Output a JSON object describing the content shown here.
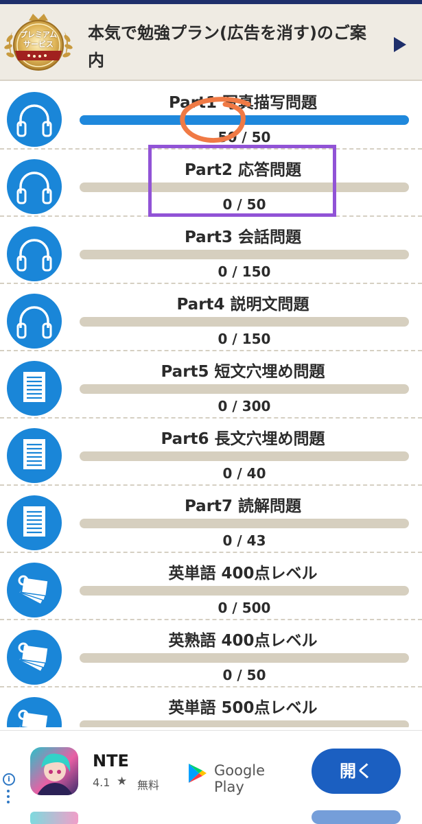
{
  "banner": {
    "badge_line1": "プレミアム",
    "badge_line2": "サービス",
    "title": "本気で勉強プラン(広告を消す)のご案内"
  },
  "rows": [
    {
      "title": "Part1 写真描写問題",
      "count": "50 / 50",
      "progress": 1.0,
      "icon": "headphones-icon"
    },
    {
      "title": "Part2 応答問題",
      "count": "0 / 50",
      "progress": 0,
      "icon": "headphones-icon"
    },
    {
      "title": "Part3 会話問題",
      "count": "0 / 150",
      "progress": 0,
      "icon": "headphones-icon"
    },
    {
      "title": "Part4 説明文問題",
      "count": "0 / 150",
      "progress": 0,
      "icon": "headphones-icon"
    },
    {
      "title": "Part5 短文穴埋め問題",
      "count": "0 / 300",
      "progress": 0,
      "icon": "document-icon"
    },
    {
      "title": "Part6 長文穴埋め問題",
      "count": "0 / 40",
      "progress": 0,
      "icon": "document-icon"
    },
    {
      "title": "Part7 読解問題",
      "count": "0 / 43",
      "progress": 0,
      "icon": "document-icon"
    },
    {
      "title": "英単語 400点レベル",
      "count": "0 / 500",
      "progress": 0,
      "icon": "flashcards-icon"
    },
    {
      "title": "英熟語 400点レベル",
      "count": "0 / 50",
      "progress": 0,
      "icon": "flashcards-icon"
    },
    {
      "title": "英単語 500点レベル",
      "count": "",
      "progress": 0,
      "icon": "flashcards-icon"
    }
  ],
  "ad": {
    "app_name": "NTE",
    "rating": "4.1",
    "price": "無料",
    "store": "Google Play",
    "open_label": "開く",
    "info": "i"
  },
  "colors": {
    "accent": "#1a86d8",
    "bar_track": "#d6cfbf",
    "highlight_box": "#9153d6",
    "annotation": "#f07a45",
    "ad_button": "#1b5fc1"
  }
}
